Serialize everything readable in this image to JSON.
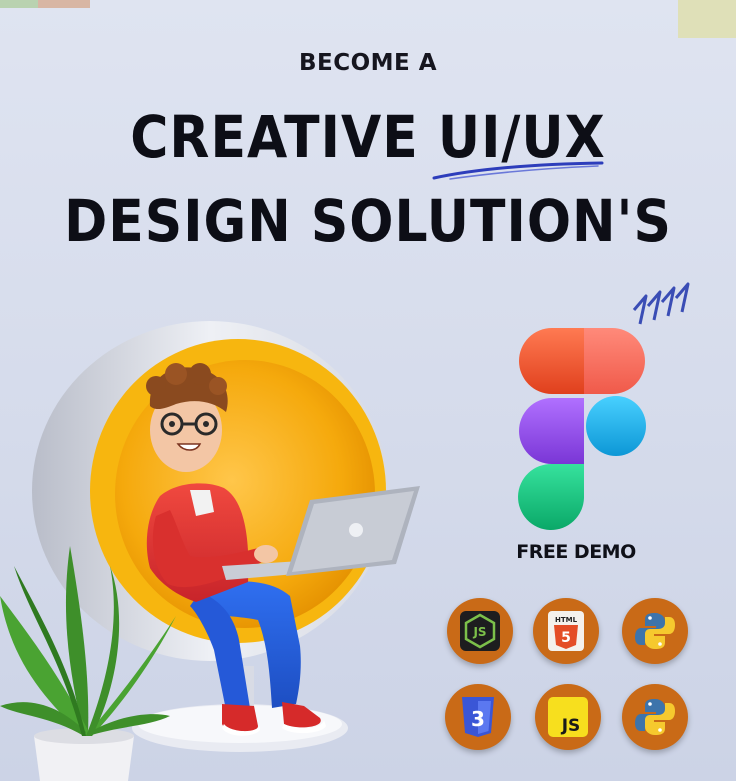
{
  "eyebrow": "BECOME A",
  "headline": {
    "line1_a": "CREATIVE ",
    "line1_b": "UI/UX",
    "line2": "DESIGN SOLUTION'S"
  },
  "cta": "FREE DEMO",
  "colors": {
    "accent_orange": "#c96a17",
    "figma_red": "#f0532c",
    "figma_purple": "#9d51f0",
    "figma_blue": "#19b7f1",
    "figma_green": "#0fcf83",
    "chair_yellow": "#f7b60f"
  },
  "tech_icons": [
    {
      "name": "nodejs-icon",
      "label": "JS"
    },
    {
      "name": "html5-icon",
      "label": "HTML",
      "badge": "5"
    },
    {
      "name": "python-icon"
    },
    {
      "name": "css3-icon",
      "badge": "3"
    },
    {
      "name": "javascript-icon",
      "label": "JS"
    },
    {
      "name": "python-icon"
    }
  ]
}
